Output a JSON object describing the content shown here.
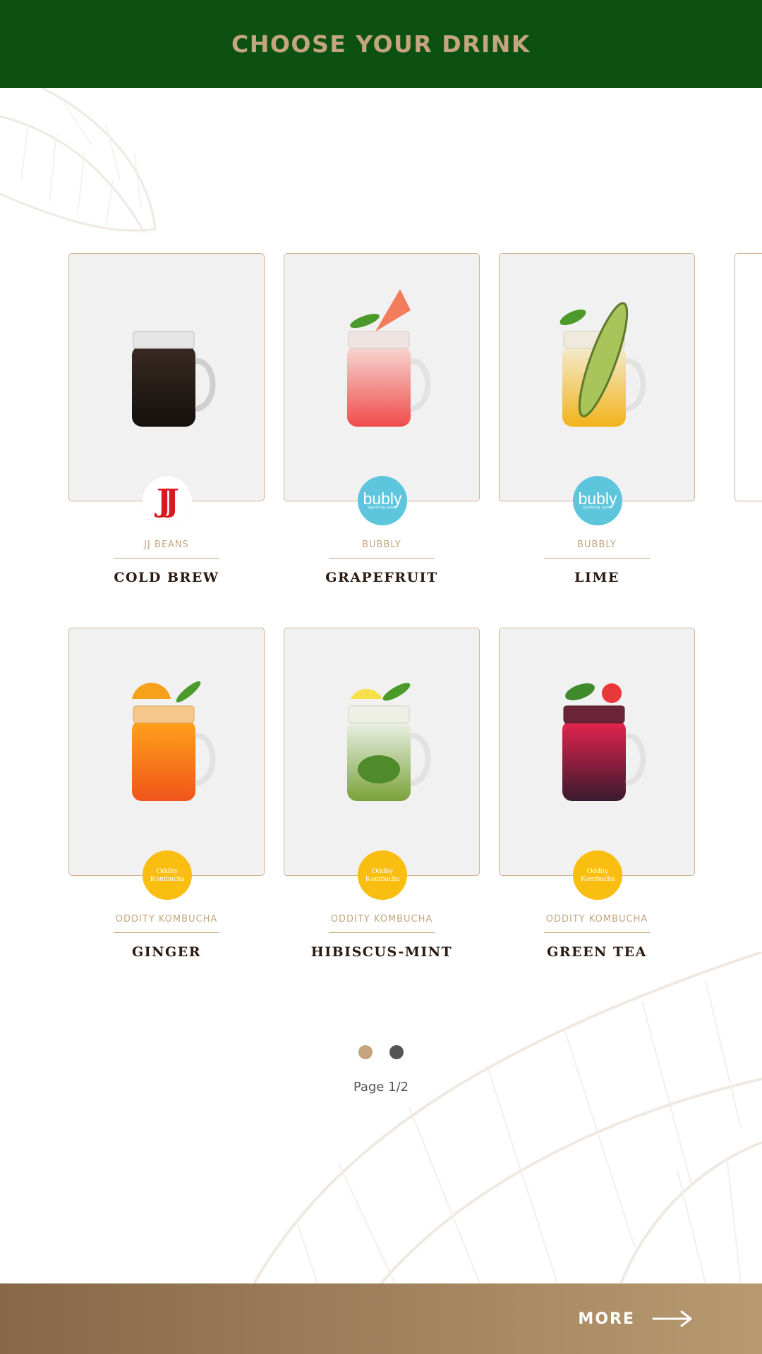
{
  "header": {
    "title": "CHOOSE YOUR DRINK"
  },
  "drinks": [
    {
      "brand": "JJ BEANS",
      "name": "COLD BREW",
      "logo_text": "JJ",
      "liquid_top": "#3a2a22",
      "liquid_bottom": "#14100d",
      "garnish": "none"
    },
    {
      "brand": "BUBBLY",
      "name": "GRAPEFRUIT",
      "logo_text": "bubly",
      "logo_sub": "sparkling water",
      "liquid_top": "#f7d9d4",
      "liquid_bottom": "#f04b4b",
      "garnish": "grapefruit-slice"
    },
    {
      "brand": "BUBBLY",
      "name": "LIME",
      "logo_text": "bubly",
      "logo_sub": "sparkling water",
      "liquid_top": "#f3ecd0",
      "liquid_bottom": "#f2b31c",
      "garnish": "cucumber"
    },
    {
      "brand": "ODDITY KOMBUCHA",
      "name": "GINGER",
      "logo_text": "Oddity Kombucha",
      "liquid_top": "#ffa31a",
      "liquid_bottom": "#f0541a",
      "garnish": "orange-slice"
    },
    {
      "brand": "ODDITY KOMBUCHA",
      "name": "HIBISCUS-MINT",
      "logo_text": "Oddity Kombucha",
      "liquid_top": "#eef3ea",
      "liquid_bottom": "#7aa23a",
      "garnish": "lemon-mint"
    },
    {
      "brand": "ODDITY KOMBUCHA",
      "name": "GREEN TEA",
      "logo_text": "Oddity Kombucha",
      "liquid_top": "#e8244e",
      "liquid_bottom": "#3a1a2e",
      "garnish": "strawberry-mint"
    }
  ],
  "pagination": {
    "label": "Page 1/2",
    "current": 1,
    "total": 2
  },
  "footer": {
    "more_label": "MORE",
    "arrow_icon": "arrow-right-icon"
  },
  "colors": {
    "header_bg": "#0d5112",
    "accent": "#c4a57e",
    "card_border": "#d3b394",
    "bubly": "#5ec6dc",
    "oddity": "#f9be10",
    "jj_red": "#d71920"
  }
}
